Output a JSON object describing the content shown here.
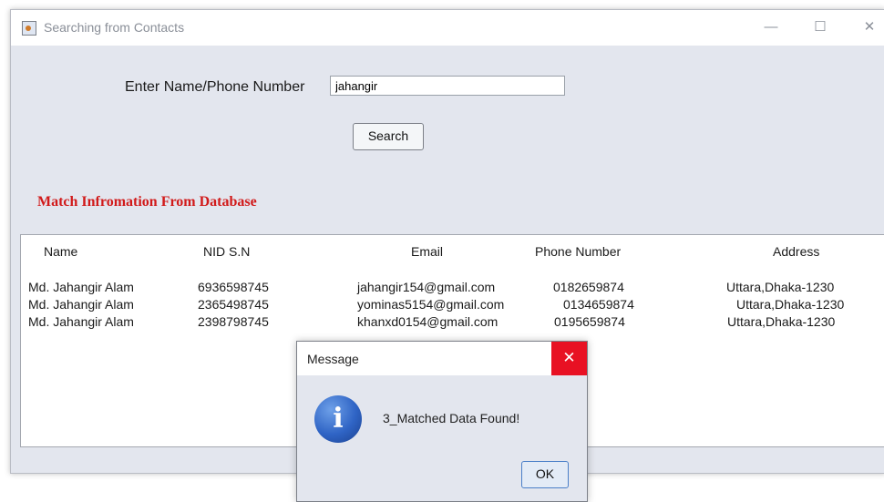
{
  "window": {
    "title": "Searching from Contacts",
    "controls": {
      "minimize": "—",
      "maximize": "☐",
      "close": "✕"
    }
  },
  "search": {
    "label": "Enter Name/Phone Number",
    "value": "jahangir",
    "button_label": "Search"
  },
  "section_heading": "Match Infromation From Database",
  "table": {
    "columns": [
      "Name",
      "NID S.N",
      "Email",
      "Phone Number",
      "Address"
    ],
    "rows": [
      [
        "Md. Jahangir Alam",
        "6936598745",
        "jahangir154@gmail.com",
        "0182659874",
        "Uttara,Dhaka-1230"
      ],
      [
        "Md. Jahangir Alam",
        "2365498745",
        "yominas5154@gmail.com",
        "0134659874",
        "Uttara,Dhaka-1230"
      ],
      [
        "Md. Jahangir Alam",
        "2398798745",
        "khanxd0154@gmail.com",
        "0195659874",
        "Uttara,Dhaka-1230"
      ]
    ]
  },
  "dialog": {
    "title": "Message",
    "close": "✕",
    "icon": "info-icon",
    "icon_glyph": "i",
    "message": "3_Matched Data Found!",
    "ok_label": "OK"
  },
  "colors": {
    "heading": "#d11a1a",
    "dialog_close": "#e81123",
    "accent": "#4a7fc8"
  }
}
